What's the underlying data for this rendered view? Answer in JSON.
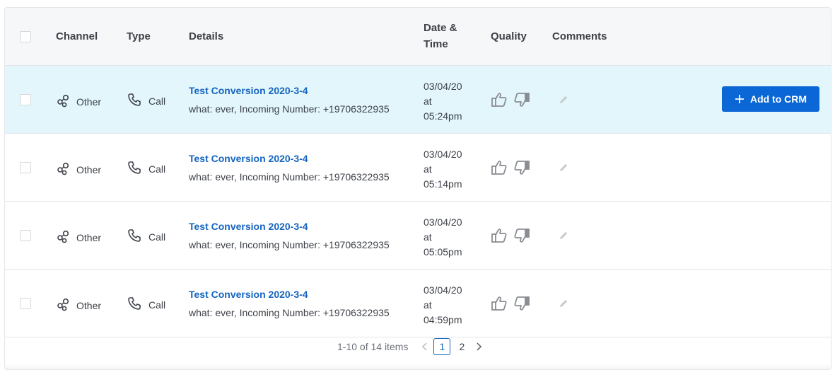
{
  "columns": {
    "channel": "Channel",
    "type": "Type",
    "details": "Details",
    "datetime_line1": "Date &",
    "datetime_line2": "Time",
    "quality": "Quality",
    "comments": "Comments"
  },
  "rows": [
    {
      "selected": true,
      "channel": "Other",
      "type": "Call",
      "title": "Test Conversion 2020-3-4",
      "subtitle": "what: ever, Incoming Number: +19706322935",
      "date": "03/04/20",
      "at": "at",
      "time": "05:24pm",
      "action_label": "Add to CRM"
    },
    {
      "selected": false,
      "channel": "Other",
      "type": "Call",
      "title": "Test Conversion 2020-3-4",
      "subtitle": "what: ever, Incoming Number: +19706322935",
      "date": "03/04/20",
      "at": "at",
      "time": "05:14pm"
    },
    {
      "selected": false,
      "channel": "Other",
      "type": "Call",
      "title": "Test Conversion 2020-3-4",
      "subtitle": "what: ever, Incoming Number: +19706322935",
      "date": "03/04/20",
      "at": "at",
      "time": "05:05pm"
    },
    {
      "selected": false,
      "channel": "Other",
      "type": "Call",
      "title": "Test Conversion 2020-3-4",
      "subtitle": "what: ever, Incoming Number: +19706322935",
      "date": "03/04/20",
      "at": "at",
      "time": "04:59pm"
    }
  ],
  "pagination": {
    "summary": "1-10 of 14 items",
    "pages": [
      "1",
      "2"
    ],
    "current": "1"
  },
  "icons": {
    "channel": "channel-nodes-icon",
    "type": "phone-icon",
    "quality_up": "thumbs-up-icon",
    "quality_down": "thumbs-down-icon",
    "comment": "pencil-icon",
    "add": "plus-icon",
    "prev": "chevron-left-icon",
    "next": "chevron-right-icon"
  },
  "colors": {
    "accent": "#0b66d6",
    "link": "#1565c0",
    "selected_row": "#e2f6fc",
    "header_bg": "#f6f7f8"
  }
}
